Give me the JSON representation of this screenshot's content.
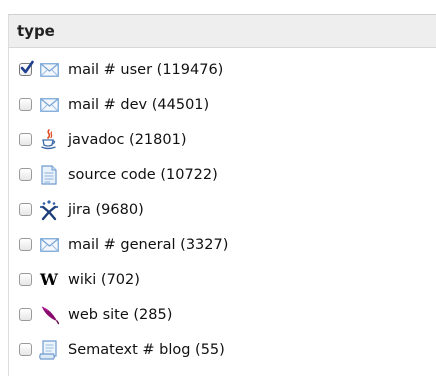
{
  "facet": {
    "title": "type",
    "items": [
      {
        "label": "mail # user (119476)",
        "checked": true,
        "icon": "mail-icon"
      },
      {
        "label": "mail # dev (44501)",
        "checked": false,
        "icon": "mail-icon"
      },
      {
        "label": "javadoc (21801)",
        "checked": false,
        "icon": "java-cup-icon"
      },
      {
        "label": "source code (10722)",
        "checked": false,
        "icon": "document-icon"
      },
      {
        "label": "jira (9680)",
        "checked": false,
        "icon": "jira-icon"
      },
      {
        "label": "mail # general (3327)",
        "checked": false,
        "icon": "mail-icon"
      },
      {
        "label": "wiki (702)",
        "checked": false,
        "icon": "wikipedia-icon"
      },
      {
        "label": "web site (285)",
        "checked": false,
        "icon": "feather-icon"
      },
      {
        "label": "Sematext # blog (55)",
        "checked": false,
        "icon": "blog-icon"
      }
    ],
    "colors": {
      "header_bg": "#eeeeee",
      "mail_icon": "#7aa7d6",
      "feather": "#8a0a6e",
      "checkmark": "#1f3f8f"
    }
  }
}
